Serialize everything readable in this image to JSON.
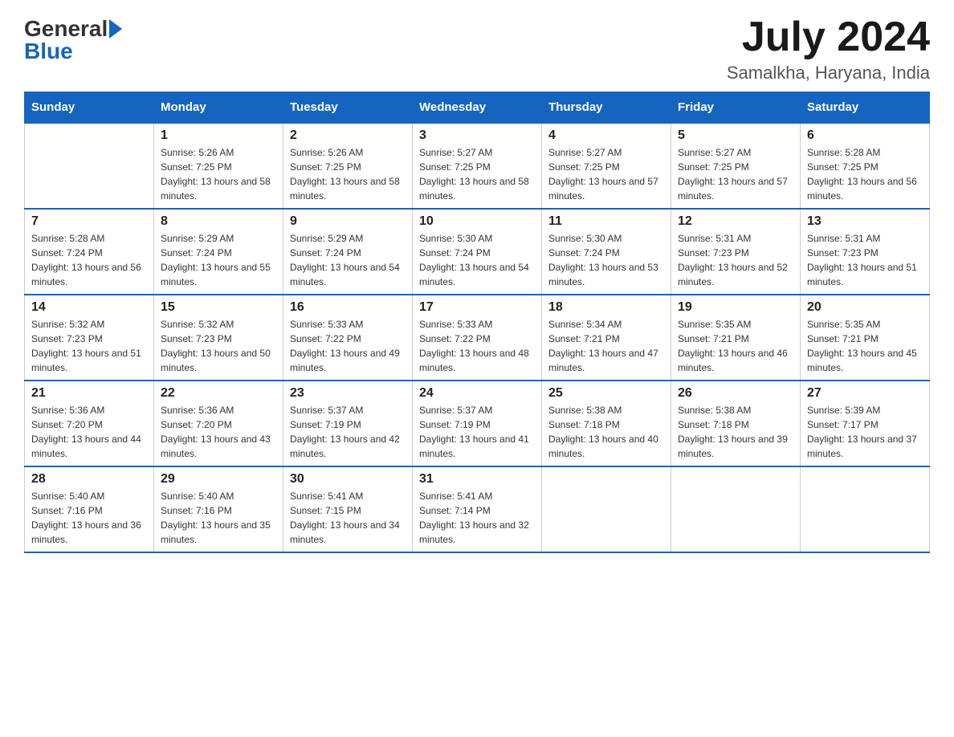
{
  "header": {
    "logo_general": "General",
    "logo_blue": "Blue",
    "month_year": "July 2024",
    "location": "Samalkha, Haryana, India"
  },
  "weekdays": [
    "Sunday",
    "Monday",
    "Tuesday",
    "Wednesday",
    "Thursday",
    "Friday",
    "Saturday"
  ],
  "weeks": [
    [
      {
        "day": "",
        "sunrise": "",
        "sunset": "",
        "daylight": ""
      },
      {
        "day": "1",
        "sunrise": "Sunrise: 5:26 AM",
        "sunset": "Sunset: 7:25 PM",
        "daylight": "Daylight: 13 hours and 58 minutes."
      },
      {
        "day": "2",
        "sunrise": "Sunrise: 5:26 AM",
        "sunset": "Sunset: 7:25 PM",
        "daylight": "Daylight: 13 hours and 58 minutes."
      },
      {
        "day": "3",
        "sunrise": "Sunrise: 5:27 AM",
        "sunset": "Sunset: 7:25 PM",
        "daylight": "Daylight: 13 hours and 58 minutes."
      },
      {
        "day": "4",
        "sunrise": "Sunrise: 5:27 AM",
        "sunset": "Sunset: 7:25 PM",
        "daylight": "Daylight: 13 hours and 57 minutes."
      },
      {
        "day": "5",
        "sunrise": "Sunrise: 5:27 AM",
        "sunset": "Sunset: 7:25 PM",
        "daylight": "Daylight: 13 hours and 57 minutes."
      },
      {
        "day": "6",
        "sunrise": "Sunrise: 5:28 AM",
        "sunset": "Sunset: 7:25 PM",
        "daylight": "Daylight: 13 hours and 56 minutes."
      }
    ],
    [
      {
        "day": "7",
        "sunrise": "Sunrise: 5:28 AM",
        "sunset": "Sunset: 7:24 PM",
        "daylight": "Daylight: 13 hours and 56 minutes."
      },
      {
        "day": "8",
        "sunrise": "Sunrise: 5:29 AM",
        "sunset": "Sunset: 7:24 PM",
        "daylight": "Daylight: 13 hours and 55 minutes."
      },
      {
        "day": "9",
        "sunrise": "Sunrise: 5:29 AM",
        "sunset": "Sunset: 7:24 PM",
        "daylight": "Daylight: 13 hours and 54 minutes."
      },
      {
        "day": "10",
        "sunrise": "Sunrise: 5:30 AM",
        "sunset": "Sunset: 7:24 PM",
        "daylight": "Daylight: 13 hours and 54 minutes."
      },
      {
        "day": "11",
        "sunrise": "Sunrise: 5:30 AM",
        "sunset": "Sunset: 7:24 PM",
        "daylight": "Daylight: 13 hours and 53 minutes."
      },
      {
        "day": "12",
        "sunrise": "Sunrise: 5:31 AM",
        "sunset": "Sunset: 7:23 PM",
        "daylight": "Daylight: 13 hours and 52 minutes."
      },
      {
        "day": "13",
        "sunrise": "Sunrise: 5:31 AM",
        "sunset": "Sunset: 7:23 PM",
        "daylight": "Daylight: 13 hours and 51 minutes."
      }
    ],
    [
      {
        "day": "14",
        "sunrise": "Sunrise: 5:32 AM",
        "sunset": "Sunset: 7:23 PM",
        "daylight": "Daylight: 13 hours and 51 minutes."
      },
      {
        "day": "15",
        "sunrise": "Sunrise: 5:32 AM",
        "sunset": "Sunset: 7:23 PM",
        "daylight": "Daylight: 13 hours and 50 minutes."
      },
      {
        "day": "16",
        "sunrise": "Sunrise: 5:33 AM",
        "sunset": "Sunset: 7:22 PM",
        "daylight": "Daylight: 13 hours and 49 minutes."
      },
      {
        "day": "17",
        "sunrise": "Sunrise: 5:33 AM",
        "sunset": "Sunset: 7:22 PM",
        "daylight": "Daylight: 13 hours and 48 minutes."
      },
      {
        "day": "18",
        "sunrise": "Sunrise: 5:34 AM",
        "sunset": "Sunset: 7:21 PM",
        "daylight": "Daylight: 13 hours and 47 minutes."
      },
      {
        "day": "19",
        "sunrise": "Sunrise: 5:35 AM",
        "sunset": "Sunset: 7:21 PM",
        "daylight": "Daylight: 13 hours and 46 minutes."
      },
      {
        "day": "20",
        "sunrise": "Sunrise: 5:35 AM",
        "sunset": "Sunset: 7:21 PM",
        "daylight": "Daylight: 13 hours and 45 minutes."
      }
    ],
    [
      {
        "day": "21",
        "sunrise": "Sunrise: 5:36 AM",
        "sunset": "Sunset: 7:20 PM",
        "daylight": "Daylight: 13 hours and 44 minutes."
      },
      {
        "day": "22",
        "sunrise": "Sunrise: 5:36 AM",
        "sunset": "Sunset: 7:20 PM",
        "daylight": "Daylight: 13 hours and 43 minutes."
      },
      {
        "day": "23",
        "sunrise": "Sunrise: 5:37 AM",
        "sunset": "Sunset: 7:19 PM",
        "daylight": "Daylight: 13 hours and 42 minutes."
      },
      {
        "day": "24",
        "sunrise": "Sunrise: 5:37 AM",
        "sunset": "Sunset: 7:19 PM",
        "daylight": "Daylight: 13 hours and 41 minutes."
      },
      {
        "day": "25",
        "sunrise": "Sunrise: 5:38 AM",
        "sunset": "Sunset: 7:18 PM",
        "daylight": "Daylight: 13 hours and 40 minutes."
      },
      {
        "day": "26",
        "sunrise": "Sunrise: 5:38 AM",
        "sunset": "Sunset: 7:18 PM",
        "daylight": "Daylight: 13 hours and 39 minutes."
      },
      {
        "day": "27",
        "sunrise": "Sunrise: 5:39 AM",
        "sunset": "Sunset: 7:17 PM",
        "daylight": "Daylight: 13 hours and 37 minutes."
      }
    ],
    [
      {
        "day": "28",
        "sunrise": "Sunrise: 5:40 AM",
        "sunset": "Sunset: 7:16 PM",
        "daylight": "Daylight: 13 hours and 36 minutes."
      },
      {
        "day": "29",
        "sunrise": "Sunrise: 5:40 AM",
        "sunset": "Sunset: 7:16 PM",
        "daylight": "Daylight: 13 hours and 35 minutes."
      },
      {
        "day": "30",
        "sunrise": "Sunrise: 5:41 AM",
        "sunset": "Sunset: 7:15 PM",
        "daylight": "Daylight: 13 hours and 34 minutes."
      },
      {
        "day": "31",
        "sunrise": "Sunrise: 5:41 AM",
        "sunset": "Sunset: 7:14 PM",
        "daylight": "Daylight: 13 hours and 32 minutes."
      },
      {
        "day": "",
        "sunrise": "",
        "sunset": "",
        "daylight": ""
      },
      {
        "day": "",
        "sunrise": "",
        "sunset": "",
        "daylight": ""
      },
      {
        "day": "",
        "sunrise": "",
        "sunset": "",
        "daylight": ""
      }
    ]
  ]
}
